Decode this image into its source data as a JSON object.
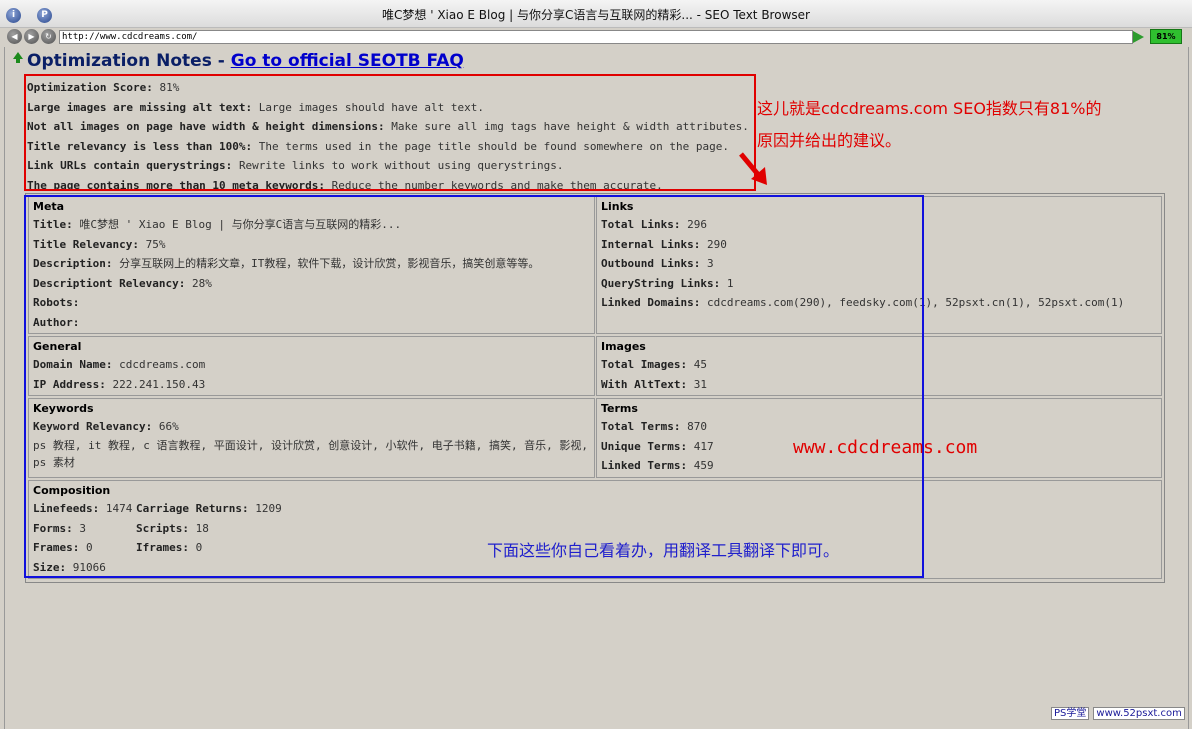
{
  "window": {
    "title": "唯C梦想 ' Xiao E Blog | 与你分享C语言与互联网的精彩... - SEO Text Browser"
  },
  "address": {
    "url": "http://www.cdcdreams.com/",
    "score_badge": "81%"
  },
  "heading": {
    "title": "Optimization Notes",
    "separator": " - ",
    "faq_link": "Go to official SEOTB FAQ"
  },
  "notes": [
    {
      "label": "Optimization Score:",
      "value": "81%"
    },
    {
      "label": "Large images are missing alt text:",
      "value": "Large images should have alt text."
    },
    {
      "label": "Not all images on page have width & height dimensions:",
      "value": "Make sure all img tags have height & width attributes."
    },
    {
      "label": "Title relevancy is less than 100%:",
      "value": "The terms used in the page title should be found somewhere on the page."
    },
    {
      "label": "Link URLs contain querystrings:",
      "value": "Rewrite links to work without using querystrings."
    },
    {
      "label": "The page contains more than 10 meta keywords:",
      "value": "Reduce the number keywords and make them accurate."
    }
  ],
  "meta": {
    "title": "Meta",
    "rows": [
      {
        "label": "Title:",
        "value": "唯C梦想 ' Xiao E Blog | 与你分享C语言与互联网的精彩..."
      },
      {
        "label": "Title Relevancy:",
        "value": "75%"
      },
      {
        "label": "Description:",
        "value": "分享互联网上的精彩文章，IT教程，软件下载，设计欣赏，影视音乐，搞笑创意等等。"
      },
      {
        "label": "Descriptiont Relevancy:",
        "value": "28%"
      },
      {
        "label": "Robots:",
        "value": ""
      },
      {
        "label": "Author:",
        "value": ""
      }
    ]
  },
  "links": {
    "title": "Links",
    "rows": [
      {
        "label": "Total Links:",
        "value": "296"
      },
      {
        "label": "Internal Links:",
        "value": "290"
      },
      {
        "label": "Outbound Links:",
        "value": "3"
      },
      {
        "label": "QueryString Links:",
        "value": "1"
      },
      {
        "label": "Linked Domains:",
        "value": "cdcdreams.com(290), feedsky.com(1), 52psxt.cn(1), 52psxt.com(1)"
      }
    ]
  },
  "general": {
    "title": "General",
    "rows": [
      {
        "label": "Domain Name:",
        "value": "cdcdreams.com"
      },
      {
        "label": "IP Address:",
        "value": "222.241.150.43"
      }
    ]
  },
  "images": {
    "title": "Images",
    "rows": [
      {
        "label": "Total Images:",
        "value": "45"
      },
      {
        "label": "With AltText:",
        "value": "31"
      }
    ]
  },
  "keywords": {
    "title": "Keywords",
    "rows": [
      {
        "label": "Keyword Relevancy:",
        "value": "66%"
      }
    ],
    "list": "ps 教程, it 教程, c 语言教程, 平面设计, 设计欣赏, 创意设计, 小软件, 电子书籍, 搞笑, 音乐, 影视, ps 素材"
  },
  "terms": {
    "title": "Terms",
    "rows": [
      {
        "label": "Total Terms:",
        "value": "870"
      },
      {
        "label": "Unique Terms:",
        "value": "417"
      },
      {
        "label": "Linked Terms:",
        "value": "459"
      }
    ]
  },
  "composition": {
    "title": "Composition",
    "cells": [
      {
        "label": "Linefeeds:",
        "value": "1474"
      },
      {
        "label": "Carriage Returns:",
        "value": "1209"
      },
      {
        "label": "Forms:",
        "value": "3"
      },
      {
        "label": "Scripts:",
        "value": "18"
      },
      {
        "label": "Frames:",
        "value": "0"
      },
      {
        "label": "Iframes:",
        "value": "0"
      },
      {
        "label": "Size:",
        "value": "91066"
      },
      {
        "label": "",
        "value": ""
      }
    ]
  },
  "annotations": {
    "red_line1": "这儿就是cdcdreams.com SEO指数只有81%的",
    "red_line2": "原因并给出的建议。",
    "url_text": "www.cdcdreams.com",
    "blue_text": "下面这些你自己看着办，用翻译工具翻译下即可。"
  },
  "watermark": {
    "left": "PS学堂",
    "right": "www.52psxt.com"
  }
}
